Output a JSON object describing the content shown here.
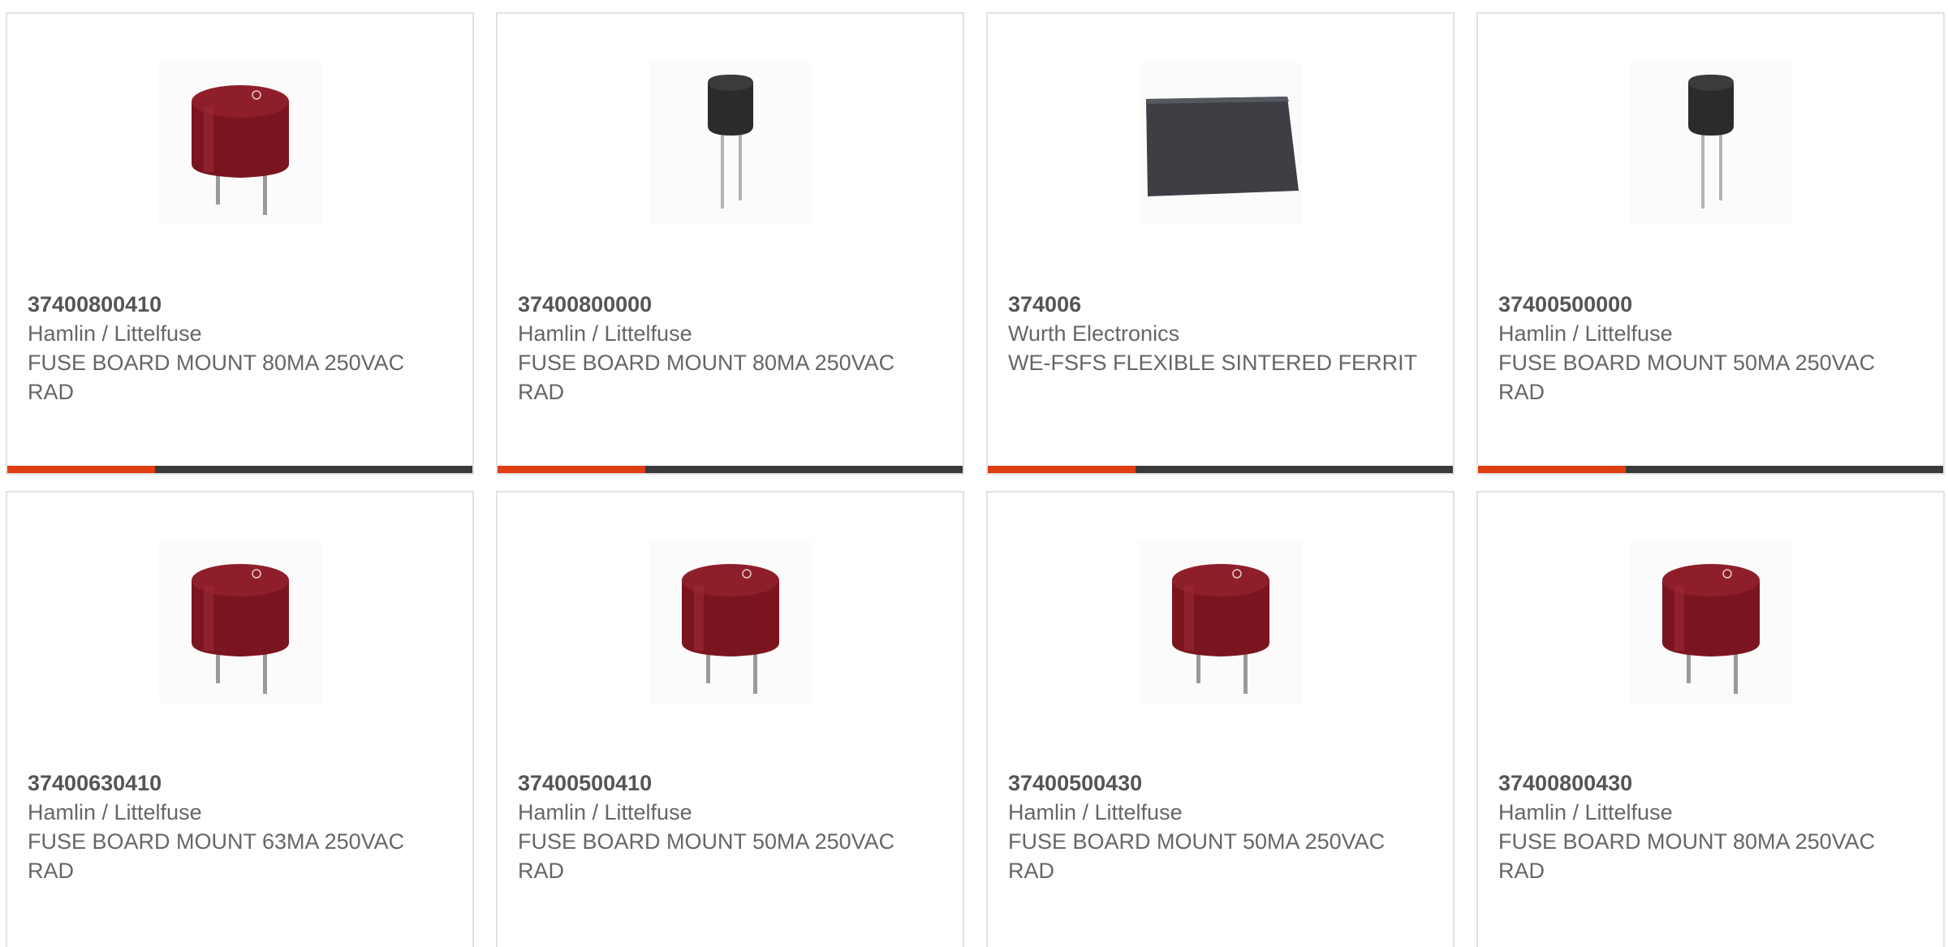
{
  "colors": {
    "accent": "#e03d11",
    "bar_dark": "#3a3a3a",
    "card_border": "#e2e2e2",
    "text": "#666666"
  },
  "products": [
    {
      "part_number": "37400800410",
      "manufacturer": "Hamlin / Littelfuse",
      "description": "FUSE BOARD MOUNT 80MA 250VAC RAD",
      "image": "red-radial-fuse-icon",
      "show_bar": true
    },
    {
      "part_number": "37400800000",
      "manufacturer": "Hamlin / Littelfuse",
      "description": "FUSE BOARD MOUNT 80MA 250VAC RAD",
      "image": "black-radial-fuse-icon",
      "show_bar": true
    },
    {
      "part_number": "374006",
      "manufacturer": "Wurth Electronics",
      "description": "WE-FSFS FLEXIBLE SINTERED FERRIT",
      "image": "ferrite-sheet-icon",
      "show_bar": true
    },
    {
      "part_number": "37400500000",
      "manufacturer": "Hamlin / Littelfuse",
      "description": "FUSE BOARD MOUNT 50MA 250VAC RAD",
      "image": "black-radial-fuse-icon",
      "show_bar": true
    },
    {
      "part_number": "37400630410",
      "manufacturer": "Hamlin / Littelfuse",
      "description": "FUSE BOARD MOUNT 63MA 250VAC RAD",
      "image": "red-radial-fuse-icon",
      "show_bar": false
    },
    {
      "part_number": "37400500410",
      "manufacturer": "Hamlin / Littelfuse",
      "description": "FUSE BOARD MOUNT 50MA 250VAC RAD",
      "image": "red-radial-fuse-icon",
      "show_bar": false
    },
    {
      "part_number": "37400500430",
      "manufacturer": "Hamlin / Littelfuse",
      "description": "FUSE BOARD MOUNT 50MA 250VAC RAD",
      "image": "red-radial-fuse-icon",
      "show_bar": false
    },
    {
      "part_number": "37400800430",
      "manufacturer": "Hamlin / Littelfuse",
      "description": "FUSE BOARD MOUNT 80MA 250VAC RAD",
      "image": "red-radial-fuse-icon",
      "show_bar": false
    }
  ]
}
